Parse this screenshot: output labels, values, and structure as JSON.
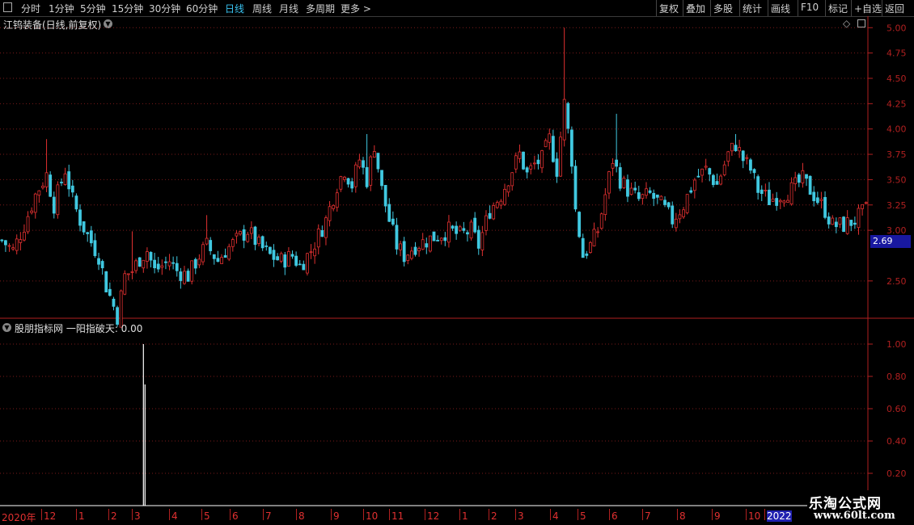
{
  "toolbar": {
    "periods": [
      "分时",
      "1分钟",
      "5分钟",
      "15分钟",
      "30分钟",
      "60分钟",
      "日线",
      "周线",
      "月线",
      "多周期",
      "更多 >"
    ],
    "active_period": "日线",
    "right_buttons": [
      "复权",
      "叠加",
      "多股",
      "统计",
      "画线",
      "F10",
      "标记",
      "+自选",
      "返回"
    ]
  },
  "main_panel": {
    "title": "江钨装备(日线,前复权)",
    "y_ticks": [
      "5.00",
      "4.75",
      "4.50",
      "4.25",
      "4.00",
      "3.75",
      "3.50",
      "3.25",
      "3.00",
      "2.50"
    ],
    "current_price": "2.69"
  },
  "sub_panel": {
    "title": "股朋指标网  一阳指破天: 0.00",
    "y_ticks": [
      "1.00",
      "0.80",
      "0.60",
      "0.40",
      "0.20"
    ]
  },
  "x_axis": {
    "labels": [
      "2020年",
      "12",
      "1",
      "2",
      "3",
      "4",
      "5",
      "6",
      "7",
      "8",
      "9",
      "10",
      "11",
      "12",
      "1",
      "2",
      "3",
      "4",
      "5",
      "6",
      "7",
      "8",
      "9",
      "10",
      "2022"
    ],
    "highlight": "2022"
  },
  "logo": {
    "line1": "乐淘公式网",
    "line2": "www.60lt.com"
  },
  "colors": {
    "up": "#e03030",
    "down": "#40c8e0",
    "grid": "#7a1a1a",
    "axis": "#b02020",
    "signal": "#ffffff",
    "active_tab": "#39c2f0"
  },
  "chart_data": {
    "type": "candlestick",
    "title": "江钨装备(日线,前复权)",
    "ylim": [
      2.1,
      5.05
    ],
    "y_ticks": [
      2.5,
      3.0,
      3.25,
      3.5,
      3.75,
      4.0,
      4.25,
      4.5,
      4.75,
      5.0
    ],
    "current_price": 2.69,
    "close_path": [
      [
        0,
        2.9
      ],
      [
        3,
        2.8
      ],
      [
        6,
        3.05
      ],
      [
        9,
        3.35
      ],
      [
        12,
        3.55
      ],
      [
        14,
        3.25
      ],
      [
        17,
        3.6
      ],
      [
        19,
        3.3
      ],
      [
        21,
        3.1
      ],
      [
        23,
        2.95
      ],
      [
        26,
        2.75
      ],
      [
        28,
        2.45
      ],
      [
        30,
        2.25
      ],
      [
        31,
        2.15
      ],
      [
        33,
        2.55
      ],
      [
        35,
        2.6
      ],
      [
        37,
        2.72
      ],
      [
        39,
        2.8
      ],
      [
        41,
        2.6
      ],
      [
        43,
        2.65
      ],
      [
        45,
        2.7
      ],
      [
        47,
        2.6
      ],
      [
        50,
        2.55
      ],
      [
        53,
        2.75
      ],
      [
        55,
        2.85
      ],
      [
        58,
        2.7
      ],
      [
        60,
        2.8
      ],
      [
        63,
        2.9
      ],
      [
        66,
        3.0
      ],
      [
        69,
        2.85
      ],
      [
        72,
        2.75
      ],
      [
        75,
        2.7
      ],
      [
        78,
        2.75
      ],
      [
        80,
        2.65
      ],
      [
        83,
        2.8
      ],
      [
        85,
        2.95
      ],
      [
        87,
        3.1
      ],
      [
        90,
        3.45
      ],
      [
        92,
        3.6
      ],
      [
        94,
        3.45
      ],
      [
        96,
        3.7
      ],
      [
        98,
        3.5
      ],
      [
        100,
        3.85
      ],
      [
        102,
        3.4
      ],
      [
        104,
        3.1
      ],
      [
        106,
        2.85
      ],
      [
        108,
        2.75
      ],
      [
        111,
        2.85
      ],
      [
        114,
        2.9
      ],
      [
        117,
        2.95
      ],
      [
        120,
        3.0
      ],
      [
        123,
        2.95
      ],
      [
        126,
        3.0
      ],
      [
        128,
        2.85
      ],
      [
        131,
        3.2
      ],
      [
        134,
        3.35
      ],
      [
        137,
        3.6
      ],
      [
        139,
        3.75
      ],
      [
        141,
        3.55
      ],
      [
        143,
        3.65
      ],
      [
        145,
        3.7
      ],
      [
        147,
        3.9
      ],
      [
        149,
        3.6
      ],
      [
        151,
        4.25
      ],
      [
        153,
        3.7
      ],
      [
        154,
        3.2
      ],
      [
        156,
        2.75
      ],
      [
        158,
        2.85
      ],
      [
        160,
        3.0
      ],
      [
        162,
        3.35
      ],
      [
        164,
        3.7
      ],
      [
        166,
        3.5
      ],
      [
        168,
        3.4
      ],
      [
        171,
        3.3
      ],
      [
        174,
        3.35
      ],
      [
        177,
        3.25
      ],
      [
        180,
        3.1
      ],
      [
        183,
        3.25
      ],
      [
        186,
        3.5
      ],
      [
        189,
        3.6
      ],
      [
        192,
        3.45
      ],
      [
        195,
        3.75
      ],
      [
        197,
        3.85
      ],
      [
        199,
        3.7
      ],
      [
        201,
        3.6
      ],
      [
        203,
        3.4
      ],
      [
        206,
        3.3
      ],
      [
        209,
        3.35
      ],
      [
        212,
        3.4
      ],
      [
        215,
        3.5
      ],
      [
        218,
        3.35
      ],
      [
        221,
        3.2
      ],
      [
        223,
        3.05
      ],
      [
        226,
        3.05
      ],
      [
        229,
        3.1
      ],
      [
        232,
        3.2
      ]
    ],
    "high_spikes": [
      [
        12,
        3.9
      ],
      [
        35,
        2.99
      ],
      [
        55,
        3.15
      ],
      [
        98,
        3.95
      ],
      [
        151,
        5.0
      ],
      [
        165,
        4.15
      ],
      [
        197,
        3.95
      ]
    ],
    "indicator": {
      "name": "一阳指破天",
      "value": 0.0,
      "ylim": [
        0,
        1.05
      ],
      "signals": [
        [
          38,
          1.0
        ]
      ]
    }
  }
}
